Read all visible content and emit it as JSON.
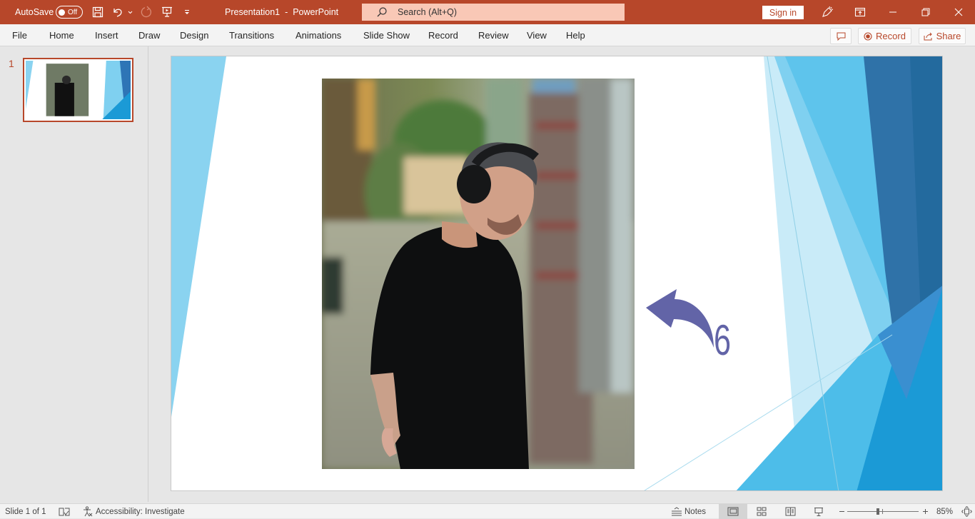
{
  "titlebar": {
    "autosave_label": "AutoSave",
    "autosave_state": "Off",
    "document_title": "Presentation1  -  PowerPoint",
    "search_placeholder": "Search (Alt+Q)",
    "signin_label": "Sign in",
    "icons": [
      "save-icon",
      "undo-icon",
      "undo-dropdown-icon",
      "redo-icon",
      "present-from-beginning-icon",
      "customize-qat-icon",
      "designer-pen-icon",
      "ribbon-display-icon",
      "minimize-icon",
      "restore-icon",
      "close-icon"
    ]
  },
  "menu": {
    "tabs": [
      "File",
      "Home",
      "Insert",
      "Draw",
      "Design",
      "Transitions",
      "Animations",
      "Slide Show",
      "Record",
      "Review",
      "View",
      "Help"
    ],
    "comments_icon": "comment-icon",
    "record_label": "Record",
    "share_label": "Share"
  },
  "thumbnails": [
    {
      "number": "1",
      "selected": true
    }
  ],
  "slide": {
    "annotation_number": "6",
    "annotation_color": "#6264a7",
    "accent_colors": [
      "#8ad3f0",
      "#5bc2eb",
      "#2e75b6",
      "#1b9ad6"
    ]
  },
  "statusbar": {
    "slide_info": "Slide 1 of 1",
    "accessibility": "Accessibility: Investigate",
    "notes_label": "Notes",
    "zoom_percent": "85%",
    "zoom_level": 0.85,
    "views": [
      "normal-view",
      "slide-sorter-view",
      "reading-view",
      "slideshow-view"
    ],
    "active_view": "normal-view"
  }
}
